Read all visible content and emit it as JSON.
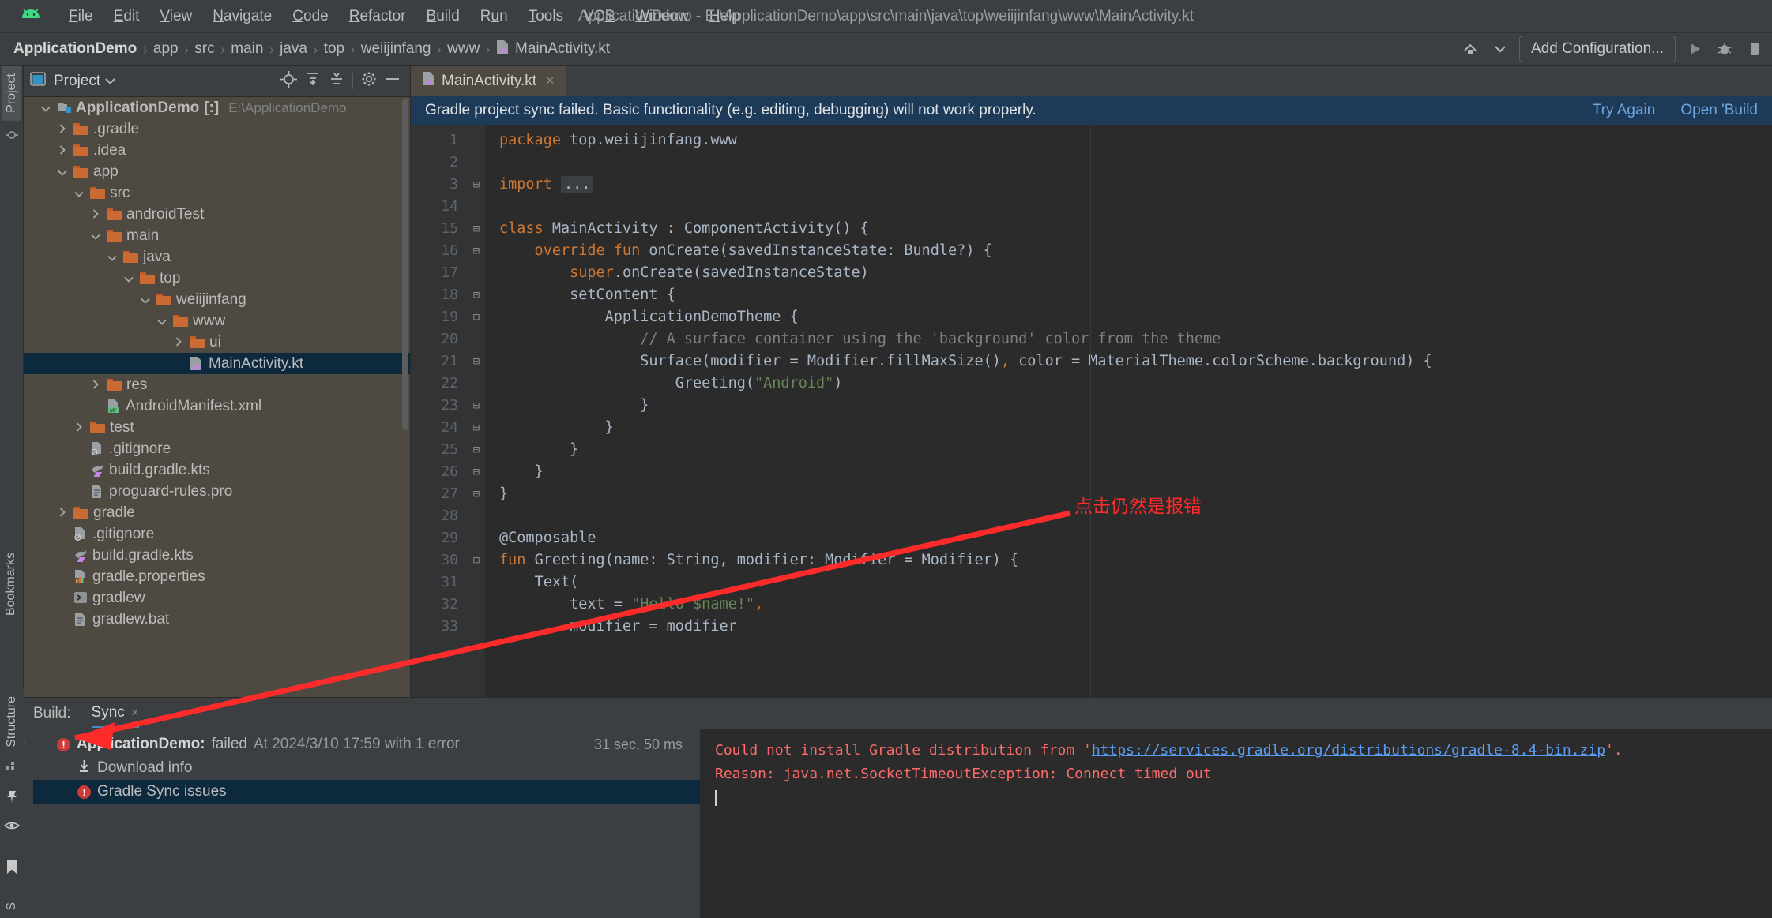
{
  "window": {
    "title": "ApplicationDemo - E:\\ApplicationDemo\\app\\src\\main\\java\\top\\weiijinfang\\www\\MainActivity.kt",
    "logo_icon": "android-logo-icon"
  },
  "menubar": {
    "items": [
      {
        "label": "File",
        "mnemonic": "F"
      },
      {
        "label": "Edit",
        "mnemonic": "E"
      },
      {
        "label": "View",
        "mnemonic": "V"
      },
      {
        "label": "Navigate",
        "mnemonic": "N"
      },
      {
        "label": "Code",
        "mnemonic": "C"
      },
      {
        "label": "Refactor",
        "mnemonic": "R"
      },
      {
        "label": "Build",
        "mnemonic": "B"
      },
      {
        "label": "Run",
        "mnemonic": "u"
      },
      {
        "label": "Tools",
        "mnemonic": "T"
      },
      {
        "label": "VCS",
        "mnemonic": "S"
      },
      {
        "label": "Window",
        "mnemonic": "W"
      },
      {
        "label": "Help",
        "mnemonic": "H"
      }
    ]
  },
  "breadcrumb": {
    "separator": "›",
    "items": [
      "ApplicationDemo",
      "app",
      "src",
      "main",
      "java",
      "top",
      "weiijinfang",
      "www",
      "MainActivity.kt"
    ]
  },
  "toolbar": {
    "sync_icon": "gradle-sync-icon",
    "dropdown_icon": "chevron-down-icon",
    "add_configuration_label": "Add Configuration...",
    "run_icon": "run-icon",
    "debug_icon": "debug-icon",
    "more_icon": "more-icon"
  },
  "left_strip": {
    "project_tab": "Project",
    "structure_tab": "Structure",
    "bookmarks_tab": "Bookmarks",
    "commit_icon": "commit-icon",
    "pin_icon": "pin-icon",
    "eye_icon": "eye-icon",
    "bookmark_icon": "bookmark-icon",
    "s_tab": "S"
  },
  "project_panel": {
    "title": "Project",
    "title_icon": "project-view-icon",
    "dropdown_icon": "chevron-down-icon",
    "locate_icon": "locate-file-icon",
    "expand_icon": "expand-all-icon",
    "collapse_icon": "collapse-all-icon",
    "settings_icon": "gear-icon",
    "hide_icon": "hide-panel-icon",
    "tree": [
      {
        "label": "ApplicationDemo",
        "suffix": "[:]",
        "hint": "E:\\ApplicationDemo",
        "depth": 0,
        "chev": "v",
        "icon": "module-icon",
        "bold": true,
        "hilite": true
      },
      {
        "label": ".gradle",
        "depth": 1,
        "chev": ">",
        "icon": "folder-icon",
        "hilite": true
      },
      {
        "label": ".idea",
        "depth": 1,
        "chev": ">",
        "icon": "folder-icon",
        "hilite": true
      },
      {
        "label": "app",
        "depth": 1,
        "chev": "v",
        "icon": "folder-icon",
        "hilite": true
      },
      {
        "label": "src",
        "depth": 2,
        "chev": "v",
        "icon": "folder-icon",
        "hilite": true
      },
      {
        "label": "androidTest",
        "depth": 3,
        "chev": ">",
        "icon": "folder-icon",
        "hilite": true
      },
      {
        "label": "main",
        "depth": 3,
        "chev": "v",
        "icon": "folder-icon",
        "hilite": true
      },
      {
        "label": "java",
        "depth": 4,
        "chev": "v",
        "icon": "folder-icon",
        "hilite": true
      },
      {
        "label": "top",
        "depth": 5,
        "chev": "v",
        "icon": "folder-icon",
        "hilite": true
      },
      {
        "label": "weiijinfang",
        "depth": 6,
        "chev": "v",
        "icon": "folder-icon",
        "hilite": true
      },
      {
        "label": "www",
        "depth": 7,
        "chev": "v",
        "icon": "folder-icon",
        "hilite": true
      },
      {
        "label": "ui",
        "depth": 8,
        "chev": ">",
        "icon": "folder-icon",
        "hilite": true
      },
      {
        "label": "MainActivity.kt",
        "depth": 8,
        "chev": "",
        "icon": "kotlin-class-icon",
        "selected": true
      },
      {
        "label": "res",
        "depth": 3,
        "chev": ">",
        "icon": "folder-icon",
        "hilite": true
      },
      {
        "label": "AndroidManifest.xml",
        "depth": 3,
        "chev": "",
        "icon": "manifest-icon",
        "hilite": true
      },
      {
        "label": "test",
        "depth": 2,
        "chev": ">",
        "icon": "folder-icon",
        "hilite": true
      },
      {
        "label": ".gitignore",
        "depth": 2,
        "chev": "",
        "icon": "gitignore-icon",
        "hilite": true
      },
      {
        "label": "build.gradle.kts",
        "depth": 2,
        "chev": "",
        "icon": "gradle-kts-icon",
        "hilite": true
      },
      {
        "label": "proguard-rules.pro",
        "depth": 2,
        "chev": "",
        "icon": "text-file-icon",
        "hilite": true
      },
      {
        "label": "gradle",
        "depth": 1,
        "chev": ">",
        "icon": "folder-icon",
        "hilite": true
      },
      {
        "label": ".gitignore",
        "depth": 1,
        "chev": "",
        "icon": "gitignore-icon"
      },
      {
        "label": "build.gradle.kts",
        "depth": 1,
        "chev": "",
        "icon": "gradle-kts-icon"
      },
      {
        "label": "gradle.properties",
        "depth": 1,
        "chev": "",
        "icon": "properties-icon"
      },
      {
        "label": "gradlew",
        "depth": 1,
        "chev": "",
        "icon": "shell-script-icon"
      },
      {
        "label": "gradlew.bat",
        "depth": 1,
        "chev": "",
        "icon": "text-file-icon"
      }
    ]
  },
  "editor": {
    "tab": {
      "label": "MainActivity.kt",
      "icon": "kotlin-class-icon",
      "close": "×"
    },
    "banner": {
      "message": "Gradle project sync failed. Basic functionality (e.g. editing, debugging) will not work properly.",
      "actions": [
        "Try Again",
        "Open 'Build"
      ]
    },
    "line_numbers": [
      "1",
      "2",
      "3",
      "14",
      "15",
      "16",
      "17",
      "18",
      "19",
      "20",
      "21",
      "22",
      "23",
      "24",
      "25",
      "26",
      "27",
      "28",
      "29",
      "30",
      "31",
      "32",
      "33"
    ],
    "lines": [
      {
        "n": "1",
        "fold": "",
        "tokens": [
          {
            "t": "package ",
            "c": "kw"
          },
          {
            "t": "top.weiijinfang.www",
            "c": "fn"
          }
        ]
      },
      {
        "n": "2",
        "fold": "",
        "tokens": []
      },
      {
        "n": "3",
        "fold": "+",
        "tokens": [
          {
            "t": "import ",
            "c": "kw"
          },
          {
            "t": "...",
            "c": "fold"
          }
        ]
      },
      {
        "n": "14",
        "fold": "",
        "tokens": []
      },
      {
        "n": "15",
        "fold": "-",
        "tokens": [
          {
            "t": "class ",
            "c": "kw"
          },
          {
            "t": "MainActivity : ComponentActivity() {",
            "c": "fn"
          }
        ]
      },
      {
        "n": "16",
        "fold": "-",
        "tokens": [
          {
            "t": "    override ",
            "c": "kw"
          },
          {
            "t": "fun ",
            "c": "kw"
          },
          {
            "t": "onCreate(savedInstanceState: Bundle?) {",
            "c": "fn"
          }
        ]
      },
      {
        "n": "17",
        "fold": "",
        "tokens": [
          {
            "t": "        ",
            "c": "fn"
          },
          {
            "t": "super",
            "c": "kw"
          },
          {
            "t": ".onCreate(savedInstanceState)",
            "c": "fn"
          }
        ]
      },
      {
        "n": "18",
        "fold": "-",
        "tokens": [
          {
            "t": "        setContent {",
            "c": "fn"
          }
        ]
      },
      {
        "n": "19",
        "fold": "-",
        "tokens": [
          {
            "t": "            ApplicationDemoTheme {",
            "c": "fn"
          }
        ]
      },
      {
        "n": "20",
        "fold": "",
        "tokens": [
          {
            "t": "                // A surface container using the 'background' color from the theme",
            "c": "cmt"
          }
        ]
      },
      {
        "n": "21",
        "fold": "-",
        "tokens": [
          {
            "t": "                Surface(modifier = Modifier.fillMaxSize()",
            "c": "fn"
          },
          {
            "t": ",",
            "c": "kw"
          },
          {
            "t": " color = MaterialTheme.colorScheme.background) {",
            "c": "fn"
          }
        ]
      },
      {
        "n": "22",
        "fold": "",
        "tokens": [
          {
            "t": "                    Greeting(",
            "c": "fn"
          },
          {
            "t": "\"Android\"",
            "c": "str"
          },
          {
            "t": ")",
            "c": "fn"
          }
        ]
      },
      {
        "n": "23",
        "fold": "-",
        "tokens": [
          {
            "t": "                }",
            "c": "fn"
          }
        ]
      },
      {
        "n": "24",
        "fold": "-",
        "tokens": [
          {
            "t": "            }",
            "c": "fn"
          }
        ]
      },
      {
        "n": "25",
        "fold": "-",
        "tokens": [
          {
            "t": "        }",
            "c": "fn"
          }
        ]
      },
      {
        "n": "26",
        "fold": "-",
        "tokens": [
          {
            "t": "    }",
            "c": "fn"
          }
        ]
      },
      {
        "n": "27",
        "fold": "-",
        "tokens": [
          {
            "t": "}",
            "c": "fn"
          }
        ]
      },
      {
        "n": "28",
        "fold": "",
        "tokens": []
      },
      {
        "n": "29",
        "fold": "",
        "tokens": [
          {
            "t": "@Composable",
            "c": "fn"
          }
        ]
      },
      {
        "n": "30",
        "fold": "-",
        "tokens": [
          {
            "t": "fun ",
            "c": "kw"
          },
          {
            "t": "Greeting(name: String, modifier: Modifier = Modifier) {",
            "c": "fn"
          }
        ]
      },
      {
        "n": "31",
        "fold": "",
        "tokens": [
          {
            "t": "    Text(",
            "c": "fn"
          }
        ]
      },
      {
        "n": "32",
        "fold": "",
        "tokens": [
          {
            "t": "        text = ",
            "c": "fn"
          },
          {
            "t": "\"Hello $name!\"",
            "c": "str"
          },
          {
            "t": ",",
            "c": "kw"
          }
        ]
      },
      {
        "n": "33",
        "fold": "",
        "tokens": [
          {
            "t": "        modifier = modifier",
            "c": "fn"
          }
        ]
      }
    ],
    "annotation": "点击仍然是报错"
  },
  "build_panel": {
    "label": "Build:",
    "tab": "Sync",
    "tab_close": "×",
    "rerun_icon": "rerun-icon",
    "stop_icon": "stop-icon",
    "rows": [
      {
        "label": "ApplicationDemo:",
        "status": "failed",
        "detail": "At 2024/3/10 17:59 with 1 error",
        "time": "31 sec, 50 ms",
        "icon": "error-icon",
        "depth": 0
      },
      {
        "label": "Download info",
        "icon": "download-icon",
        "depth": 1
      },
      {
        "label": "Gradle Sync issues",
        "icon": "error-icon",
        "depth": 1,
        "selected": true
      }
    ],
    "console": {
      "line1_pre": "Could not install Gradle distribution from '",
      "line1_url": "https://services.gradle.org/distributions/gradle-8.4-bin.zip",
      "line1_post": "'.",
      "line2": "Reason: java.net.SocketTimeoutException: Connect timed out"
    }
  },
  "colors": {
    "accent_blue": "#4a88c7",
    "banner_blue": "#1d3a58",
    "selection_blue": "#0d293e",
    "error_red": "#ff6b68",
    "annotation_red": "#ff2b2b",
    "keyword_orange": "#cc7832",
    "string_green": "#6a8759",
    "link_blue": "#589df6",
    "tree_hilite": "#4e4a42"
  }
}
